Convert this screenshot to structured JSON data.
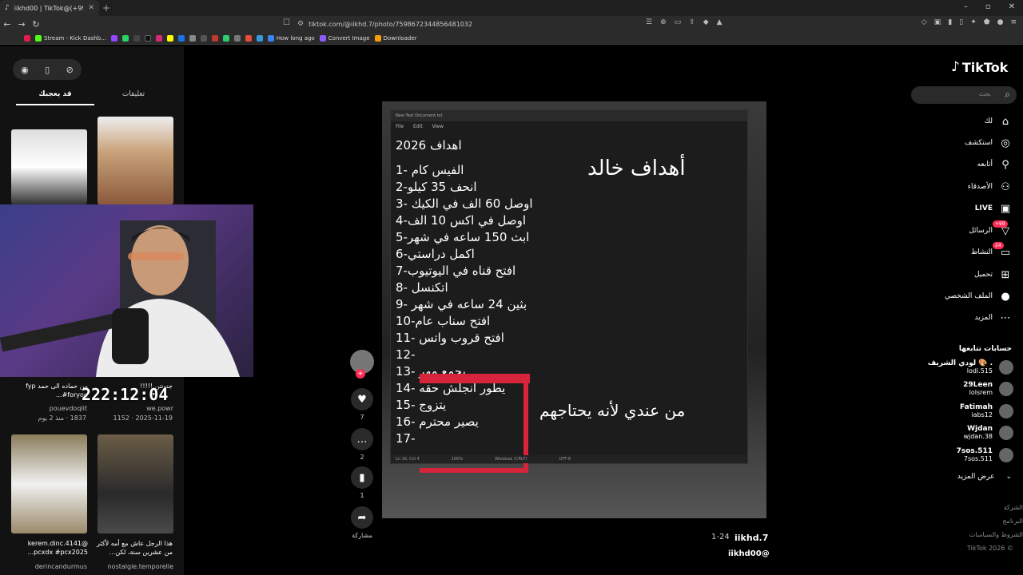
{
  "browser": {
    "tab_title": "iikhd00 | TikTok@(+99)",
    "new_tab": "+",
    "url": "tiktok.com/@iikhd.7/photo/7598672344856481032",
    "bookmarks": [
      {
        "label": "Stream - Kick Dashb...",
        "color": "#53fc18"
      },
      {
        "label": "How long ago",
        "color": "#3b82f6"
      },
      {
        "label": "Convert Image",
        "color": "#8b5cf6"
      },
      {
        "label": "Downloader",
        "color": "#f59e0b"
      }
    ]
  },
  "left_panel": {
    "tabs": {
      "comments": "تعليقات",
      "for_you": "قد يعجبك"
    },
    "items": [
      {
        "caption": "",
        "user": "",
        "meta": ""
      },
      {
        "caption": "",
        "user": "",
        "meta": ""
      },
      {
        "caption": "من حماده الى حمد fyp #foryou...",
        "user": "pouevdoqlit",
        "meta": "1837 · منذ 2 يوم"
      },
      {
        "caption": "جنونتن !!!!!",
        "user": "we.powr",
        "meta": "2025-11-19 · 1152"
      },
      {
        "caption": "@kerem.dinc.4141 pcxdx #pcx2025...",
        "user": "derincandurmus",
        "meta": ""
      },
      {
        "caption": "هذا الرجل عاش مع أمه لأكثر من عشرين سنة، لكن...",
        "user": "nostalgie.temporelle",
        "meta": ""
      }
    ]
  },
  "stream_clock": "222:12:04",
  "post": {
    "overlay_title": "أهداف خالد",
    "overlay_side": "من عندي لأنه يحتاجهم",
    "notepad_tab": "New Text Document.txt",
    "notepad_menu": [
      "File",
      "Edit",
      "View"
    ],
    "notepad_status": [
      "Ln 16, Col 4",
      "100%",
      "Windows (CRLF)",
      "UTF-8"
    ],
    "lines": [
      "اهداف 2026",
      "1- الفيس كام",
      "2-انحف 35 كيلو",
      "3- اوصل 60 الف في الكيك",
      "4-اوصل في اكس 10 الف",
      "5-ابث 150 ساعه في شهر",
      "6-اكمل دراستي",
      "7-افتح قناه في اليوتيوب",
      "8- اتكنسل",
      "9- بثين 24 ساعه في شهر",
      "10-افتح سناب عام",
      "11- افتح قروب واتس",
      "12-",
      "13-  يجمع مهر",
      "14-  يطور انجلش حقه",
      "15-  يتزوج",
      "16-  يصير محترم",
      "17-"
    ],
    "actions": {
      "likes": "7",
      "comments": "2",
      "saves": "1",
      "share": "مشاركة"
    },
    "counter": "1-24",
    "author": "iikhd.7",
    "handle": "iikhd00@"
  },
  "nav": {
    "logo": "TikTok",
    "search_placeholder": "بحث",
    "items": [
      {
        "label": "لك"
      },
      {
        "label": "استكشف"
      },
      {
        "label": "أتابعه"
      },
      {
        "label": "الأصدقاء"
      },
      {
        "label": "LIVE"
      },
      {
        "label": "الرسائل",
        "badge": "+99"
      },
      {
        "label": "النشاط",
        "badge": "24"
      },
      {
        "label": "تحميل"
      },
      {
        "label": "الملف الشخصي"
      },
      {
        "label": "المزيد"
      }
    ],
    "following_heading": "حسابات تتابعها",
    "following": [
      {
        "name": "لودي الشريف 🎨 .",
        "handle": "lodi.515"
      },
      {
        "name": "29Leen",
        "handle": "lolsrem"
      },
      {
        "name": "Fatimah",
        "handle": "iabs12"
      },
      {
        "name": "Wjdan",
        "handle": "wjdan.38"
      },
      {
        "name": "7sos.511",
        "handle": "7sos.511"
      }
    ],
    "see_more": "عرض المزيد",
    "footer": [
      "الشركة",
      "البرنامج",
      "الشروط والسياسات",
      "TikTok 2026 ©"
    ]
  }
}
